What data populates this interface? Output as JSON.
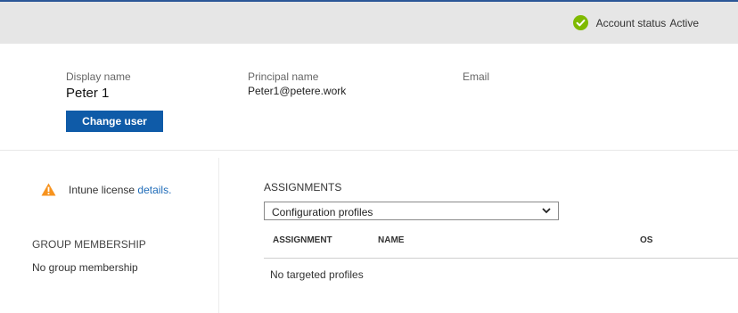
{
  "header": {
    "status_label": "Account status",
    "status_value": "Active",
    "status_icon": "check-circle-icon",
    "status_color": "#7fba00"
  },
  "user": {
    "display_name_label": "Display name",
    "display_name": "Peter 1",
    "principal_label": "Principal name",
    "principal_value": "Peter1@petere.work",
    "email_label": "Email",
    "change_user_label": "Change user"
  },
  "sidebar": {
    "license_text": "Intune license",
    "license_link": "details.",
    "license_icon": "warning-icon",
    "group_title": "GROUP MEMBERSHIP",
    "group_empty": "No group membership"
  },
  "assignments": {
    "title": "ASSIGNMENTS",
    "selected": "Configuration profiles",
    "columns": [
      "ASSIGNMENT",
      "NAME",
      "OS"
    ],
    "empty_text": "No targeted profiles"
  },
  "colors": {
    "accent": "#0f5ba8",
    "warning": "#f7931e",
    "link": "#1e6bb8"
  }
}
